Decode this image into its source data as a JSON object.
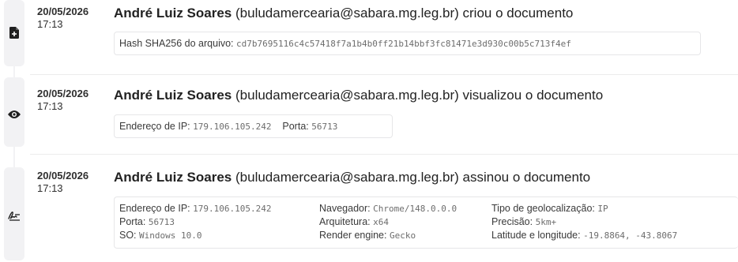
{
  "events": [
    {
      "icon": "file-add-icon",
      "date": "20/05/2026",
      "time": "17:13",
      "name": "André Luiz Soares",
      "email": "(buludamercearia@sabara.mg.leg.br)",
      "action": "criou o documento",
      "hash_label": "Hash SHA256 do arquivo:",
      "hash_value": "cd7b7695116c4c57418f7a1b4b0ff21b14bbf3fc81471e3d930c00b5c713f4ef"
    },
    {
      "icon": "eye-icon",
      "date": "20/05/2026",
      "time": "17:13",
      "name": "André Luiz Soares",
      "email": "(buludamercearia@sabara.mg.leg.br)",
      "action": "visualizou o documento",
      "ip_label": "Endereço de IP:",
      "ip_value": "179.106.105.242",
      "port_label": "Porta:",
      "port_value": "56713"
    },
    {
      "icon": "signature-icon",
      "date": "20/05/2026",
      "time": "17:13",
      "name": "André Luiz Soares",
      "email": "(buludamercearia@sabara.mg.leg.br)",
      "action": "assinou o documento",
      "ip_label": "Endereço de IP:",
      "ip_value": "179.106.105.242",
      "port_label": "Porta:",
      "port_value": "56713",
      "os_label": "SO:",
      "os_value": "Windows 10.0",
      "browser_label": "Navegador:",
      "browser_value": "Chrome/148.0.0.0",
      "arch_label": "Arquitetura:",
      "arch_value": "x64",
      "engine_label": "Render engine:",
      "engine_value": "Gecko",
      "geo_type_label": "Tipo de geolocalização:",
      "geo_type_value": "IP",
      "precision_label": "Precisão:",
      "precision_value": "5km+",
      "latlng_label": "Latitude e longitude:",
      "latlng_value": "-19.8864, -43.8067"
    }
  ]
}
